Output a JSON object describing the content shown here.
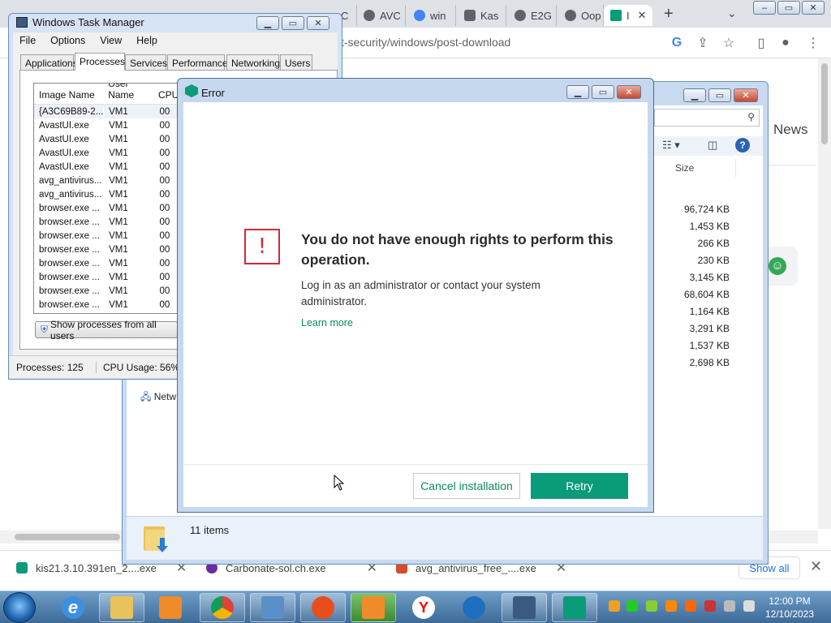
{
  "browser": {
    "tabs": [
      {
        "label": "C"
      },
      {
        "label": "AVC"
      },
      {
        "label": "win"
      },
      {
        "label": "Kas"
      },
      {
        "label": "E2G"
      },
      {
        "label": "Oop"
      },
      {
        "label": "I"
      }
    ],
    "address": "t-security/windows/post-download",
    "page_news": "News",
    "new_tab_symbol": "+",
    "tab_close_symbol": "✕"
  },
  "downloads": {
    "items": [
      {
        "name": "kis21.3.10.391en_2....exe",
        "color": "#0a9b78"
      },
      {
        "name": "Carbonate-sol.ch.exe",
        "color": "#6a2ca0"
      },
      {
        "name": "avg_antivirus_free_....exe",
        "color": "#d44d2a"
      }
    ],
    "show_all": "Show all"
  },
  "explorer": {
    "size_header": "Size",
    "sizes": [
      "96,724 KB",
      "1,453 KB",
      "266 KB",
      "230 KB",
      "3,145 KB",
      "68,604 KB",
      "1,164 KB",
      "3,291 KB",
      "1,537 KB",
      "2,698 KB"
    ],
    "status_items": "11 items",
    "network_label": "Netw"
  },
  "taskmgr": {
    "title": "Windows Task Manager",
    "menu": [
      "File",
      "Options",
      "View",
      "Help"
    ],
    "tabs": [
      "Applications",
      "Processes",
      "Services",
      "Performance",
      "Networking",
      "Users"
    ],
    "active_tab": "Processes",
    "columns": {
      "image": "Image Name",
      "user": "User Name",
      "cpu": "CPU"
    },
    "rows": [
      {
        "image": "{A3C69B89-2...",
        "user": "VM1",
        "cpu": "00"
      },
      {
        "image": "AvastUI.exe",
        "user": "VM1",
        "cpu": "00"
      },
      {
        "image": "AvastUI.exe",
        "user": "VM1",
        "cpu": "00"
      },
      {
        "image": "AvastUI.exe",
        "user": "VM1",
        "cpu": "00"
      },
      {
        "image": "AvastUI.exe",
        "user": "VM1",
        "cpu": "00"
      },
      {
        "image": "avg_antivirus...",
        "user": "VM1",
        "cpu": "00"
      },
      {
        "image": "avg_antivirus...",
        "user": "VM1",
        "cpu": "00"
      },
      {
        "image": "browser.exe ...",
        "user": "VM1",
        "cpu": "00"
      },
      {
        "image": "browser.exe ...",
        "user": "VM1",
        "cpu": "00"
      },
      {
        "image": "browser.exe ...",
        "user": "VM1",
        "cpu": "00"
      },
      {
        "image": "browser.exe ...",
        "user": "VM1",
        "cpu": "00"
      },
      {
        "image": "browser.exe ...",
        "user": "VM1",
        "cpu": "00"
      },
      {
        "image": "browser.exe ...",
        "user": "VM1",
        "cpu": "00"
      },
      {
        "image": "browser.exe ...",
        "user": "VM1",
        "cpu": "00"
      },
      {
        "image": "browser.exe ...",
        "user": "VM1",
        "cpu": "00"
      }
    ],
    "show_all_button": "Show processes from all users",
    "status": {
      "processes": "Processes: 125",
      "cpu": "CPU Usage: 56%"
    }
  },
  "error_dialog": {
    "title": "Error",
    "heading": "You do not have enough rights to perform this operation.",
    "message": "Log in as an administrator or contact your system administrator.",
    "link": "Learn more",
    "cancel_label": "Cancel installation",
    "retry_label": "Retry",
    "mark": "!",
    "accent": "#0a9b78",
    "alert_color": "#d3293b"
  },
  "taskbar": {
    "time": "12:00 PM",
    "date": "12/10/2023",
    "apps": [
      "ie-icon",
      "explorer-icon",
      "media-player-icon",
      "chrome-icon",
      "control-panel-icon",
      "ccleaner-icon",
      "avast-icon",
      "yandex-icon",
      "app-icon",
      "task-manager-icon",
      "kaspersky-icon"
    ]
  }
}
